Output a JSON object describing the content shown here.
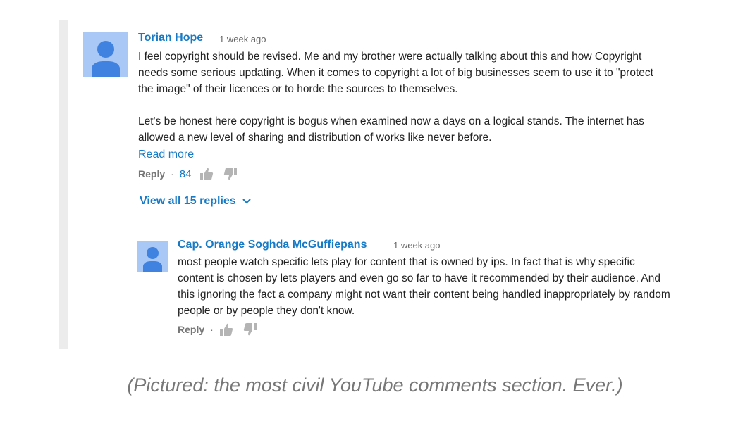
{
  "comment": {
    "author": "Torian Hope",
    "time": "1 week ago",
    "text": "I feel copyright should be revised. Me and my brother were actually talking about this and how Copyright needs some serious updating. When it comes to copyright a lot of big businesses seem to use it to \"protect the image\" of their licences or to horde the sources to themselves.\n\nLet's be honest here copyright is bogus when examined now a days on a logical stands. The internet has allowed a new level of sharing and distribution of works like never before.",
    "read_more": "Read more",
    "reply_label": "Reply",
    "separator": "·",
    "likes": "84",
    "view_replies": "View all 15 replies"
  },
  "reply": {
    "author": "Cap. Orange Soghda McGuffiepans",
    "time": "1 week ago",
    "text": "most people watch specific lets play for content that is owned by ips. In fact that is why specific content is chosen by lets players and even go so far to have it recommended by their audience. And this ignoring the fact a company might not want their content being handled inappropriately by random people or by people they don't know.",
    "reply_label": "Reply",
    "separator": "·"
  },
  "caption": "(Pictured: the most civil YouTube comments section. Ever.)",
  "icons": {
    "like": "thumbs-up-icon",
    "dislike": "thumbs-down-icon",
    "expand": "chevron-down-icon",
    "avatar": "default-user-avatar"
  },
  "colors": {
    "link": "#167ac6",
    "avatar_bg": "#a9c8f5",
    "avatar_fg": "#3f82e0",
    "border": "#ececec",
    "icon": "#b4b4b4"
  }
}
